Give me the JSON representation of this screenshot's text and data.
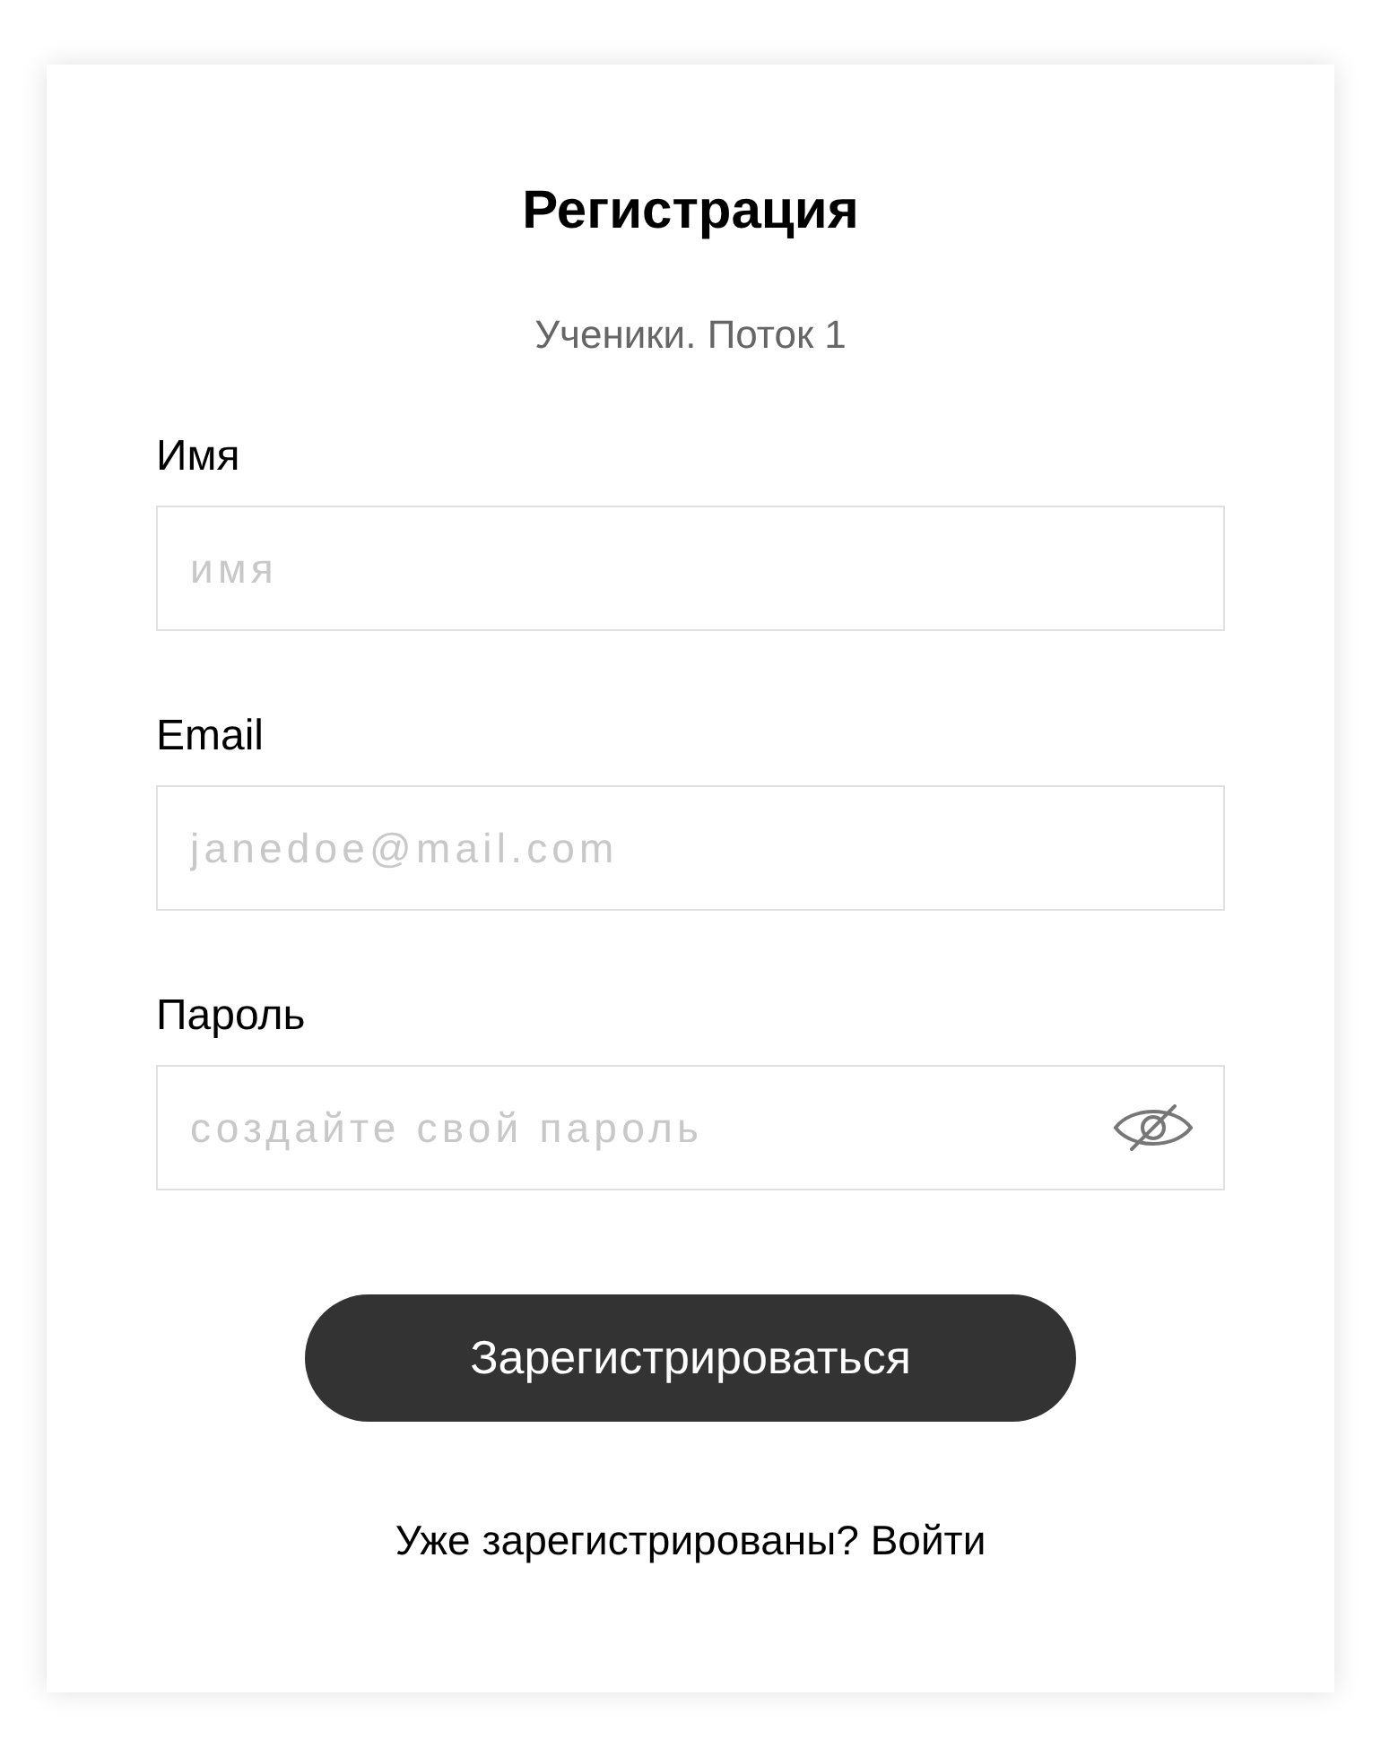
{
  "card": {
    "title": "Регистрация",
    "subtitle": "Ученики. Поток 1"
  },
  "fields": [
    {
      "kind": "text",
      "label": "Имя",
      "placeholder": "имя"
    },
    {
      "kind": "text",
      "label": "Email",
      "placeholder": "janedoe@mail.com"
    },
    {
      "kind": "password",
      "label": "Пароль",
      "placeholder": "создайте свой пароль",
      "revealed": false
    }
  ],
  "submit_button": "Зарегистрироваться",
  "login_prompt": {
    "text": "Уже зарегистрированы?",
    "link": "Войти"
  }
}
